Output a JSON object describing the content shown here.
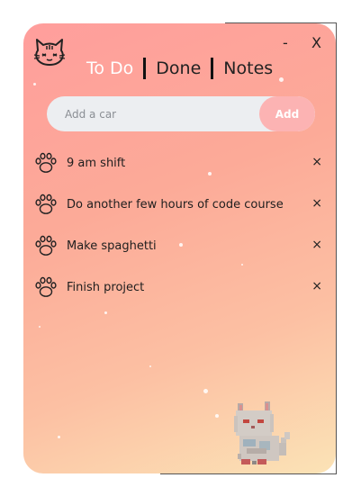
{
  "window": {
    "minimize_label": "-",
    "close_label": "X",
    "gradient_start": "#ff9e9c",
    "gradient_end": "#fbe3b6"
  },
  "logo": {
    "icon": "cat-face-icon"
  },
  "tabs": [
    {
      "label": "To Do",
      "active": true
    },
    {
      "label": "Done",
      "active": false
    },
    {
      "label": "Notes",
      "active": false
    }
  ],
  "new_task": {
    "placeholder": "Add a car",
    "value": "",
    "add_label": "Add"
  },
  "tasks": [
    {
      "text": "9 am shift",
      "icon": "paw-icon",
      "delete_label": "×"
    },
    {
      "text": "Do another few hours of code course",
      "icon": "paw-icon",
      "delete_label": "×"
    },
    {
      "text": "Make spaghetti",
      "icon": "paw-icon",
      "delete_label": "×"
    },
    {
      "text": "Finish project",
      "icon": "paw-icon",
      "delete_label": "×"
    }
  ],
  "decoration": {
    "image": "pixel-cat-illustration"
  },
  "colors": {
    "active_tab": "#ffffff",
    "input_bg": "#eceef1",
    "add_button": "#fcb3b3"
  }
}
